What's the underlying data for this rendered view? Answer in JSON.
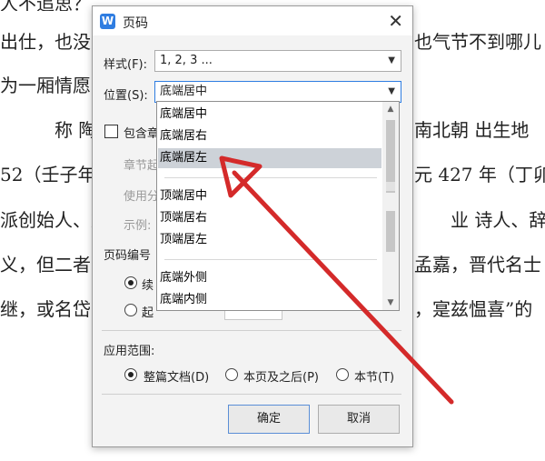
{
  "document": {
    "lines": [
      "出仕，也没",
      "也气节不到哪儿",
      "为一厢情愿",
      "称  陶潜",
      "南北朝  出生地",
      "52（壬子年",
      "元 427 年（丁卯",
      "派创始人、文",
      "业  诗人、辞",
      "义，但二者",
      "孟嘉，晋代名士",
      "继，或名岱",
      "，寔兹愠喜”的"
    ]
  },
  "dialog": {
    "title": "页码",
    "app_icon": "W",
    "close": "✕",
    "style_label": "样式(F):",
    "style_value": "1, 2, 3 ...",
    "position_label": "位置(S):",
    "position_value": "底端居中",
    "include_label": "包含章",
    "chapter_label": "章节起",
    "use_label": "使用分",
    "example_label": "示例:",
    "numbering_label": "页码编号",
    "continue_label": "续",
    "start_label": "起",
    "range_label": "应用范围:",
    "range_options": [
      "整篇文档(D)",
      "本页及之后(P)",
      "本节(T)"
    ],
    "ok_label": "确定",
    "cancel_label": "取消"
  },
  "dropdown": {
    "items": [
      "底端居中",
      "底端居右",
      "底端居左",
      "顶端居中",
      "顶端居右",
      "顶端居左",
      "底端外侧",
      "底端内侧"
    ],
    "selected": "底端居左"
  },
  "colors": {
    "accent": "#2f7de1",
    "arrow": "#d42a2a",
    "highlight": "#cdd2d8"
  }
}
